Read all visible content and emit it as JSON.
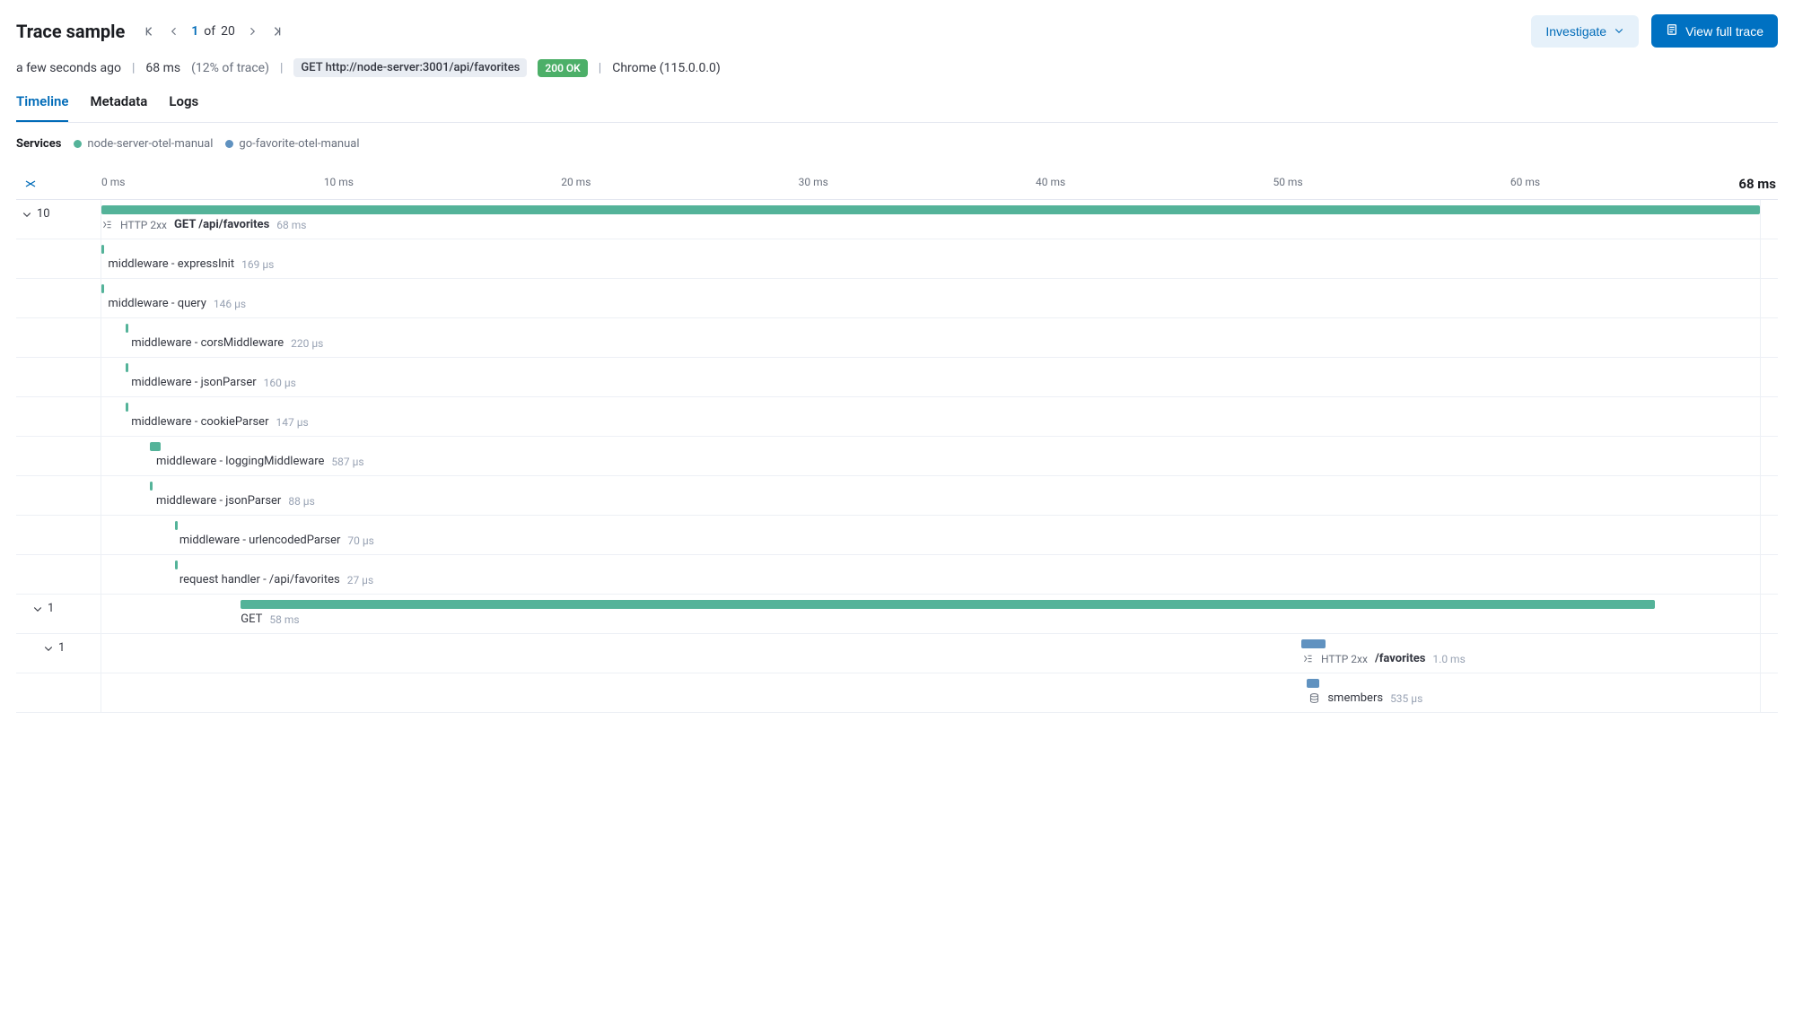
{
  "header": {
    "title": "Trace sample",
    "pager": {
      "current": "1",
      "of_label": "of",
      "total": "20"
    },
    "investigate_label": "Investigate",
    "view_full_label": "View full trace"
  },
  "meta": {
    "age": "a few seconds ago",
    "duration": "68 ms",
    "pct_of_trace": "(12% of trace)",
    "request_chip": "GET http://node-server:3001/api/favorites",
    "status_chip": "200 OK",
    "client": "Chrome (115.0.0.0)"
  },
  "tabs": {
    "timeline": "Timeline",
    "metadata": "Metadata",
    "logs": "Logs"
  },
  "services": {
    "label": "Services",
    "items": [
      {
        "name": "node-server-otel-manual",
        "color": "green"
      },
      {
        "name": "go-favorite-otel-manual",
        "color": "blue"
      }
    ]
  },
  "axis": {
    "ticks": [
      "0 ms",
      "10 ms",
      "20 ms",
      "30 ms",
      "40 ms",
      "50 ms",
      "60 ms"
    ],
    "end": "68 ms"
  },
  "chart_data": {
    "type": "gantt",
    "x_unit": "ms",
    "x_range": [
      0,
      68
    ],
    "total_ms": 68,
    "spans": [
      {
        "id": "root",
        "service": "node-server-otel-manual",
        "color": "green",
        "http_status": "HTTP 2xx",
        "name": "GET /api/favorites",
        "name_bold": true,
        "duration_label": "68 ms",
        "start_ms": 0,
        "width_ms": 68,
        "thin": false,
        "icon": "span",
        "child_count": 10,
        "depth": 0,
        "label_offset_pct": 0
      },
      {
        "id": "mw-expressinit",
        "service": "node-server-otel-manual",
        "color": "green",
        "name": "middleware - expressInit",
        "duration_label": "169 µs",
        "start_ms": 0,
        "width_ms": 0.169,
        "thin": true,
        "depth": 1,
        "label_offset_pct": 0.4
      },
      {
        "id": "mw-query",
        "service": "node-server-otel-manual",
        "color": "green",
        "name": "middleware - query",
        "duration_label": "146 µs",
        "start_ms": 0,
        "width_ms": 0.146,
        "thin": true,
        "depth": 1,
        "label_offset_pct": 0.4
      },
      {
        "id": "mw-cors",
        "service": "node-server-otel-manual",
        "color": "green",
        "name": "middleware - corsMiddleware",
        "duration_label": "220 µs",
        "start_ms": 1,
        "width_ms": 0.22,
        "thin": true,
        "depth": 1,
        "label_offset_pct": 1.8
      },
      {
        "id": "mw-jsonparser1",
        "service": "node-server-otel-manual",
        "color": "green",
        "name": "middleware - jsonParser",
        "duration_label": "160 µs",
        "start_ms": 1,
        "width_ms": 0.16,
        "thin": true,
        "depth": 1,
        "label_offset_pct": 1.8
      },
      {
        "id": "mw-cookie",
        "service": "node-server-otel-manual",
        "color": "green",
        "name": "middleware - cookieParser",
        "duration_label": "147 µs",
        "start_ms": 1,
        "width_ms": 0.147,
        "thin": true,
        "depth": 1,
        "label_offset_pct": 1.8
      },
      {
        "id": "mw-logging",
        "service": "node-server-otel-manual",
        "color": "green",
        "name": "middleware - loggingMiddleware",
        "duration_label": "587 µs",
        "start_ms": 2,
        "width_ms": 0.587,
        "thin": false,
        "depth": 1,
        "label_offset_pct": 3.3
      },
      {
        "id": "mw-jsonparser2",
        "service": "node-server-otel-manual",
        "color": "green",
        "name": "middleware - jsonParser",
        "duration_label": "88 µs",
        "start_ms": 2,
        "width_ms": 0.088,
        "thin": true,
        "depth": 1,
        "label_offset_pct": 3.3
      },
      {
        "id": "mw-urlencoded",
        "service": "node-server-otel-manual",
        "color": "green",
        "name": "middleware - urlencodedParser",
        "duration_label": "70 µs",
        "start_ms": 3,
        "width_ms": 0.07,
        "thin": true,
        "depth": 1,
        "label_offset_pct": 4.7
      },
      {
        "id": "req-handler",
        "service": "node-server-otel-manual",
        "color": "green",
        "name": "request handler - /api/favorites",
        "duration_label": "27 µs",
        "start_ms": 3,
        "width_ms": 0.027,
        "thin": true,
        "depth": 1,
        "label_offset_pct": 4.7
      },
      {
        "id": "get",
        "service": "node-server-otel-manual",
        "color": "green",
        "name": "GET",
        "duration_label": "58 ms",
        "start_ms": 5.7,
        "width_ms": 58,
        "thin": false,
        "depth": 1,
        "child_count": 1,
        "label_offset_pct": 8.4
      },
      {
        "id": "favorites",
        "service": "go-favorite-otel-manual",
        "color": "blue",
        "http_status": "HTTP 2xx",
        "name": "/favorites",
        "name_bold": true,
        "duration_label": "1.0 ms",
        "start_ms": 49.2,
        "width_ms": 1.0,
        "thin": false,
        "icon": "span",
        "depth": 2,
        "child_count": 1,
        "label_offset_pct": 72.4
      },
      {
        "id": "smembers",
        "service": "go-favorite-otel-manual",
        "color": "blue",
        "name": "smembers",
        "duration_label": "535 µs",
        "start_ms": 49.4,
        "width_ms": 0.535,
        "thin": false,
        "icon": "db",
        "depth": 3,
        "label_offset_pct": 72.8
      }
    ]
  }
}
